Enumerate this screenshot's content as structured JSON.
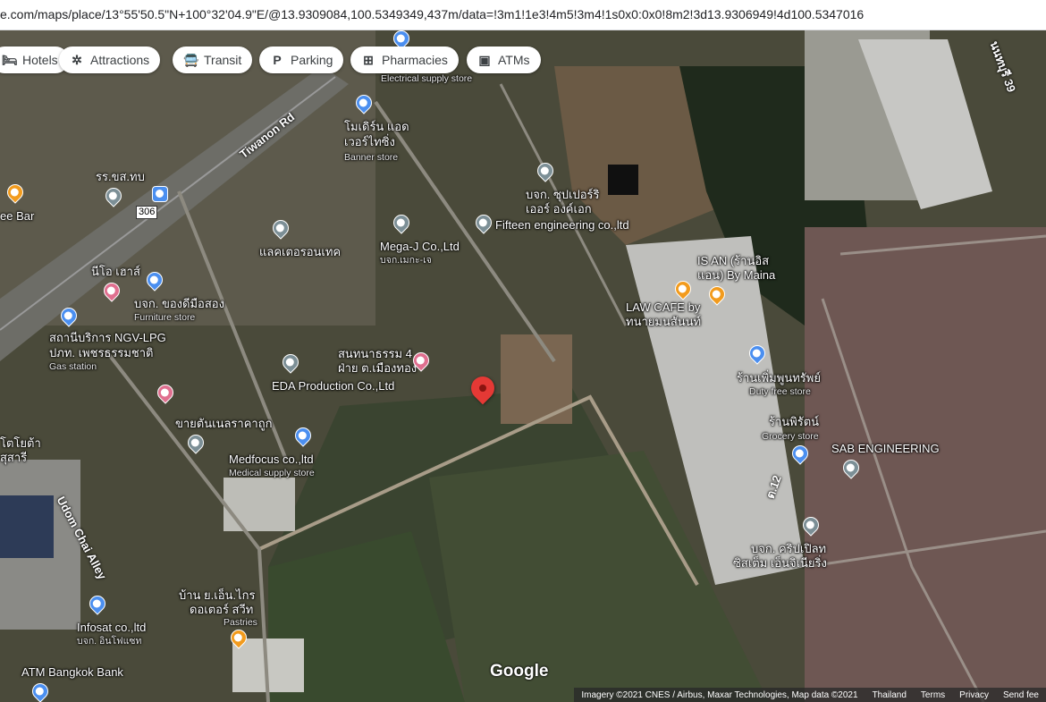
{
  "url": "e.com/maps/place/13°55'50.5\"N+100°32'04.9\"E/@13.9309084,100.5349349,437m/data=!3m1!1e3!4m5!3m4!1s0x0:0x0!8m2!3d13.9306949!4d100.5347016",
  "chips": [
    {
      "label": "Hotels",
      "icon": "hotel-icon",
      "glyph": "🛏"
    },
    {
      "label": "Attractions",
      "icon": "attractions-icon",
      "glyph": "✲"
    },
    {
      "label": "Transit",
      "icon": "transit-icon",
      "glyph": "🚍"
    },
    {
      "label": "Parking",
      "icon": "parking-icon",
      "glyph": "P"
    },
    {
      "label": "Pharmacies",
      "icon": "pharmacy-icon",
      "glyph": "⊞"
    },
    {
      "label": "ATMs",
      "icon": "atm-icon",
      "glyph": "▣"
    }
  ],
  "roads": {
    "tiwanon": "Tiwanon Rd",
    "udom": "Udom Chai Alley",
    "route": "306",
    "soi39": "นนทบุรี 39",
    "soi12": "ต.12"
  },
  "places": {
    "electrical": "Electrical supply store",
    "modern": "โมเดิร์น แอด",
    "modern2": "เวอร์ไทซิ่ง",
    "banner": "Banner store",
    "school": "รร.ขส.ทบ",
    "bar": "ee Bar",
    "supreme": "บจก. ซุปเปอร์ริ",
    "supreme2": "เออร์ องค์เอก",
    "fifteen": "Fifteen engineering co.,ltd",
    "megaj": "Mega-J Co.,Ltd",
    "megaj2": "บจก.เมกะ-เจ",
    "intech": "แลคเตอรอนเทค",
    "neo": "นีโอ เฮาส์",
    "furniture": "บจก. ของดีมือสอง",
    "furniture2": "Furniture store",
    "ngv": "สถานีบริการ NGV-LPG",
    "ngv2": "ปภท. เพชรธรรมชาติ",
    "gas": "Gas station",
    "isan": "IS AN (ร้านอิส",
    "isan2": "แอน) By Maina",
    "lawcafe": "LAW CAFE by",
    "lawcafe2": "ทนายมนสันนท์",
    "sanamnam": "สนทนาธรรม 4",
    "sanamnam2": "ฝ่าย ต.เมืองทอง",
    "eda": "EDA Production Co.,Ltd",
    "dutyfree": "ร้านเพิ่มพูนทรัพย์",
    "dutyfree2": "Duty free store",
    "grocery": "ร้านพิรัตน์",
    "grocery2": "Grocery store",
    "sab": "SAB ENGINEERING",
    "toyota": "โตโยต้า",
    "toyota2": "สุสารี",
    "salemodern": "ขายตันเนลราคาถูก",
    "medfocus": "Medfocus co.,ltd",
    "medfocus2": "Medical supply store",
    "crystal": "บจก. คริปเปิลท",
    "crystal2": "ซิสเต็ม เอ็นจิเนียริ่ง",
    "pastry": "บ้าน ย.เอ็น.ไกร",
    "pastry2": "ดอเตอร์ สวีท",
    "pastry3": "Pastries",
    "infosat": "Infosat co.,ltd",
    "infosat2": "บจก. อินโฟแซท",
    "atmbkk": "ATM Bangkok Bank"
  },
  "google": "Google",
  "footer": {
    "imagery": "Imagery ©2021 CNES / Airbus, Maxar Technologies, Map data ©2021",
    "country": "Thailand",
    "terms": "Terms",
    "privacy": "Privacy",
    "feedback": "Send fee"
  }
}
